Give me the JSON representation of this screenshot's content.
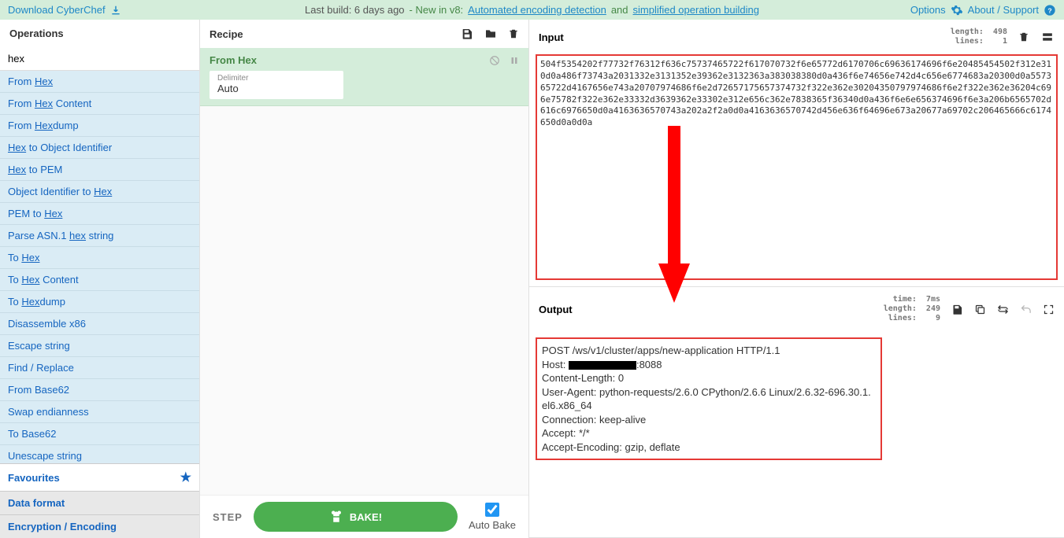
{
  "banner": {
    "download": "Download CyberChef",
    "build": "Last build: 6 days ago",
    "new_prefix": " - New in v8: ",
    "new_feat1": "Automated encoding detection",
    "and": " and ",
    "new_feat2": "simplified operation building",
    "options": "Options",
    "about": "About / Support"
  },
  "ops": {
    "title": "Operations",
    "search": "hex",
    "items": [
      "From <u>Hex</u>",
      "From <u>Hex</u> Content",
      "From <u>Hex</u>dump",
      "<u>Hex</u> to Object Identifier",
      "<u>Hex</u> to PEM",
      "Object Identifier to <u>Hex</u>",
      "PEM to <u>Hex</u>",
      "Parse ASN.1 <u>hex</u> string",
      "To <u>Hex</u>",
      "To <u>Hex</u> Content",
      "To <u>Hex</u>dump",
      "Disassemble x86",
      "Escape string",
      "Find / Replace",
      "From Base62",
      "Swap endianness",
      "To Base62",
      "Unescape string"
    ],
    "fav": "Favourites",
    "cat1": "Data format",
    "cat2": "Encryption / Encoding"
  },
  "recipe": {
    "title": "Recipe",
    "op_name": "From Hex",
    "param_label": "Delimiter",
    "param_value": "Auto",
    "step": "STEP",
    "bake": "BAKE!",
    "auto": "Auto Bake"
  },
  "input": {
    "title": "Input",
    "stats": "length:  498\nlines:    1",
    "text": "504f5354202f77732f76312f636c75737465722f617070732f6e65772d6170706c69636174696f6e20485454502f312e310d0a486f73743a2031332e3131352e39362e3132363a383038380d0a436f6e74656e742d4c656e6774683a20300d0a557365722d4167656e743a20707974686f6e2d72657175657374732f322e362e30204350797974686f6e2f322e362e36204c696e75782f322e362e33332d3639362e33302e312e656c362e7838365f36340d0a436f6e6e656374696f6e3a206b6565702d616c6976650d0a4163636570743a202a2f2a0d0a4163636570742d456e636f64696e673a20677a69702c206465666c6174650d0a0d0a"
  },
  "output": {
    "title": "Output",
    "stats": "  time:  7ms\nlength:  249\n lines:    9",
    "lines": [
      "POST /ws/v1/cluster/apps/new-application HTTP/1.1",
      "Host: [REDACTED]:8088",
      "Content-Length: 0",
      "User-Agent: python-requests/2.6.0 CPython/2.6.6 Linux/2.6.32-696.30.1.el6.x86_64",
      "Connection: keep-alive",
      "Accept: */*",
      "Accept-Encoding: gzip, deflate"
    ]
  }
}
